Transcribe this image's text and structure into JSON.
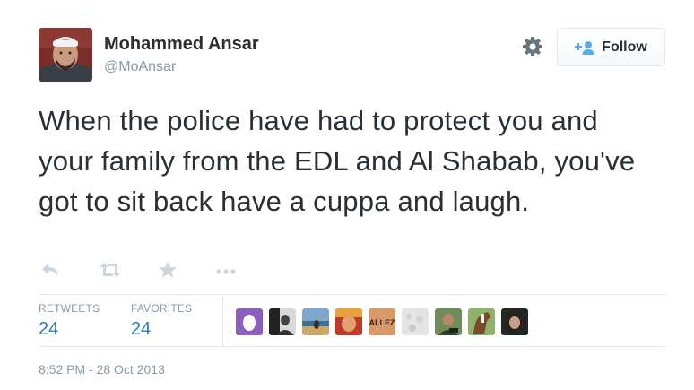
{
  "author": {
    "name": "Mohammed Ansar",
    "handle": "@MoAnsar"
  },
  "follow_button": {
    "label": "Follow",
    "icon": "follow-plus-person-icon"
  },
  "settings_icon": "gear-icon",
  "tweet": {
    "text": "When the police have had to protect you and your family from the EDL and Al Shabab, you've got to sit back have a cuppa and laugh."
  },
  "actions": [
    {
      "name": "reply",
      "icon": "reply-icon"
    },
    {
      "name": "retweet",
      "icon": "retweet-icon"
    },
    {
      "name": "favorite",
      "icon": "star-icon"
    },
    {
      "name": "more",
      "icon": "more-dots-icon"
    }
  ],
  "stats": {
    "retweets_label": "RETWEETS",
    "retweets_count": "24",
    "favorites_label": "FAVORITES",
    "favorites_count": "24"
  },
  "favoriter_avatars": {
    "count": 9,
    "items": [
      {
        "style": "purple-egg"
      },
      {
        "style": "dark-figure"
      },
      {
        "style": "beach-scene"
      },
      {
        "style": "warm-portrait"
      },
      {
        "style": "allez-text",
        "text": "ALLEZ"
      },
      {
        "style": "grey-texture"
      },
      {
        "style": "green-portrait"
      },
      {
        "style": "horse"
      },
      {
        "style": "dark-hair-portrait"
      }
    ]
  },
  "timestamp": "8:52 PM - 28 Oct 2013",
  "colors": {
    "text": "#292f33",
    "muted": "#8899a6",
    "link_blue": "#2b7bb9",
    "follow_icon_blue": "#55acee",
    "border": "#e1e8ed"
  }
}
